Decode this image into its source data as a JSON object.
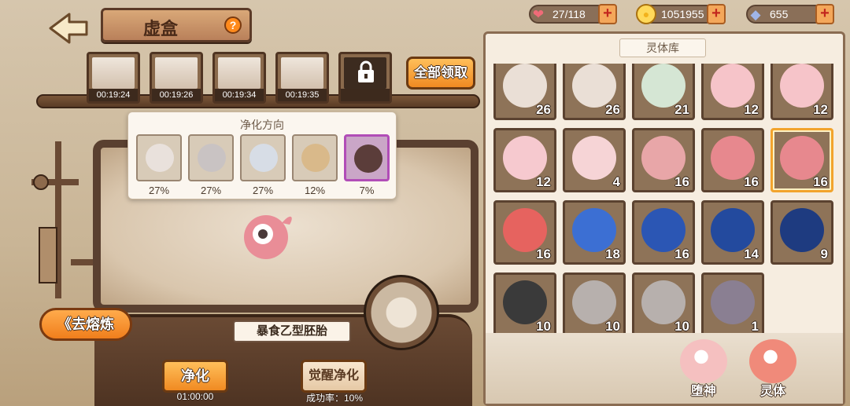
{
  "header": {
    "title": "虚盒",
    "help_glyph": "?"
  },
  "resources": {
    "stamina": {
      "value": "27/118",
      "icon": "heart-icon",
      "color": "#f06b78"
    },
    "gold": {
      "value": "1051955",
      "icon": "coin-icon",
      "color": "#f2b21c"
    },
    "crystal": {
      "value": "655",
      "icon": "crystal-icon",
      "color": "#9fb4e6"
    },
    "plus_glyph": "+"
  },
  "slots": [
    {
      "time": "00:19:24"
    },
    {
      "time": "00:19:26"
    },
    {
      "time": "00:19:34"
    },
    {
      "time": "00:19:35"
    },
    {
      "locked": true,
      "icon": "lock-icon"
    }
  ],
  "claim_all_label": "全部领取",
  "purify_panel": {
    "title": "净化方向",
    "options": [
      {
        "percent": "27%",
        "color": "#e9e1dc"
      },
      {
        "percent": "27%",
        "color": "#c9c3c3"
      },
      {
        "percent": "27%",
        "color": "#d7dde6"
      },
      {
        "percent": "12%",
        "color": "#d9b98a"
      },
      {
        "percent": "7%",
        "color": "#5b3d3a",
        "selected": true
      }
    ]
  },
  "machine": {
    "go_refine_label": "《去熔炼",
    "target_name": "暴食乙型胚胎",
    "purify_label": "净化",
    "purify_time": "01:00:00",
    "awaken_label": "觉醒净化",
    "success_rate": "成功率：10%"
  },
  "inventory": {
    "tab": "灵体库",
    "items": [
      {
        "count": "26",
        "color": "#eadfd6"
      },
      {
        "count": "26",
        "color": "#eadfd6"
      },
      {
        "count": "21",
        "color": "#d5e6d4"
      },
      {
        "count": "12",
        "color": "#f6c4c9"
      },
      {
        "count": "12",
        "color": "#f6c4c9"
      },
      {
        "count": "12",
        "color": "#f6c9cf"
      },
      {
        "count": "4",
        "color": "#f6d4d6"
      },
      {
        "count": "16",
        "color": "#e8a6a8"
      },
      {
        "count": "16",
        "color": "#e7888e"
      },
      {
        "count": "16",
        "color": "#e7888e",
        "selected": true
      },
      {
        "count": "16",
        "color": "#e6635f"
      },
      {
        "count": "18",
        "color": "#3c6fd3"
      },
      {
        "count": "16",
        "color": "#2b56b4"
      },
      {
        "count": "14",
        "color": "#234a9e"
      },
      {
        "count": "9",
        "color": "#1e3b80"
      },
      {
        "count": "10",
        "color": "#3a3a3a"
      },
      {
        "count": "10",
        "color": "#b7b0ad"
      },
      {
        "count": "10",
        "color": "#b7b0ad"
      },
      {
        "count": "1",
        "color": "#8a7f92"
      }
    ]
  },
  "bottom_nav": [
    {
      "label": "堕神",
      "color": "#f5c0c0"
    },
    {
      "label": "灵体",
      "color": "#f08a7a"
    }
  ]
}
